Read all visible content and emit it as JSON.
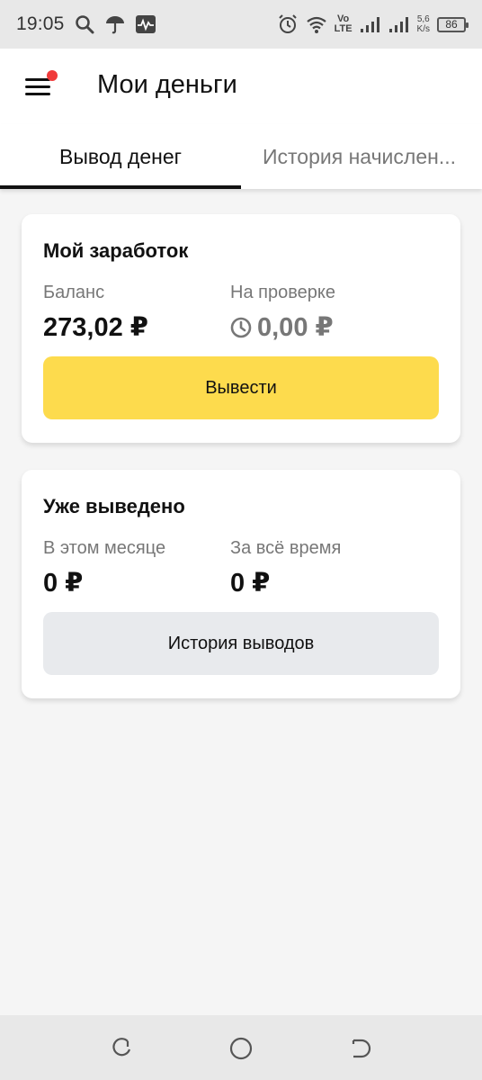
{
  "status_bar": {
    "time": "19:05",
    "volte_top": "Vo",
    "volte_bottom": "LTE",
    "speed_value": "5,6",
    "speed_unit": "K/s",
    "battery": "86"
  },
  "app_bar": {
    "title": "Мои деньги",
    "menu_icon": "hamburger-menu-icon",
    "notification_dot_color": "#f03a3a"
  },
  "tabs": [
    {
      "label": "Вывод денег",
      "active": true
    },
    {
      "label": "История начислен...",
      "active": false
    }
  ],
  "earnings_card": {
    "title": "Мой заработок",
    "balance_label": "Баланс",
    "balance_value": "273,02 ₽",
    "pending_label": "На проверке",
    "pending_value": "0,00 ₽",
    "pending_icon": "clock-icon",
    "withdraw_button": "Вывести"
  },
  "withdrawn_card": {
    "title": "Уже выведено",
    "month_label": "В этом месяце",
    "month_value": "0 ₽",
    "alltime_label": "За всё время",
    "alltime_value": "0 ₽",
    "history_button": "История выводов"
  },
  "colors": {
    "accent_yellow": "#fddb4d",
    "secondary_button": "#e8eaed",
    "background": "#f5f5f5"
  },
  "nav_bar": {
    "icons": [
      "recent-apps-icon",
      "home-icon",
      "back-icon"
    ]
  }
}
